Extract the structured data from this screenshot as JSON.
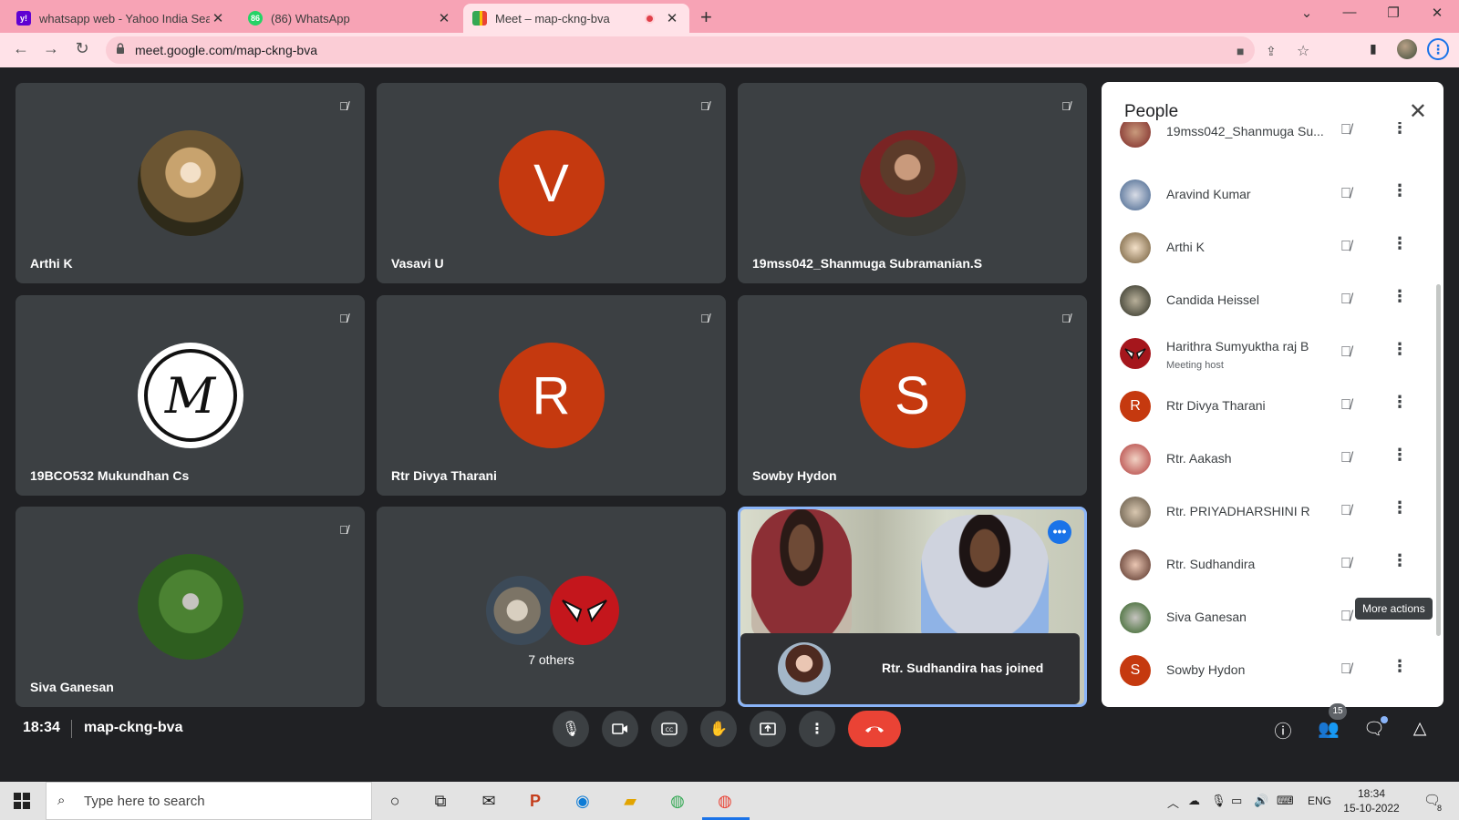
{
  "browser": {
    "tabs": [
      {
        "title": "whatsapp web - Yahoo India Sea",
        "favicon": "yahoo-icon",
        "color": "#6001d2"
      },
      {
        "title": "(86) WhatsApp",
        "favicon": "whatsapp-icon",
        "badge": "86",
        "color": "#25d366"
      },
      {
        "title": "Meet – map-ckng-bva",
        "favicon": "meet-icon",
        "recording": true
      }
    ],
    "url": "meet.google.com/map-ckng-bva"
  },
  "tiles": [
    {
      "name": "Arthi K",
      "avatar": "photo",
      "muted": true
    },
    {
      "name": "Vasavi U",
      "avatar": "letter",
      "letter": "V",
      "muted": true
    },
    {
      "name": "19mss042_Shanmuga Subramanian.S",
      "avatar": "photo",
      "muted": true
    },
    {
      "name": "19BCO532 Mukundhan Cs",
      "avatar": "logo",
      "letter": "M",
      "muted": true
    },
    {
      "name": "Rtr Divya Tharani",
      "avatar": "letter",
      "letter": "R",
      "muted": true
    },
    {
      "name": "Sowby Hydon",
      "avatar": "letter",
      "letter": "S",
      "muted": true
    },
    {
      "name": "Siva Ganesan",
      "avatar": "photo",
      "muted": true
    },
    {
      "name": "7 others",
      "avatar": "group"
    }
  ],
  "toast": {
    "message": "Rtr. Sudhandira has joined"
  },
  "people_panel": {
    "title": "People",
    "participants": [
      {
        "name": "19mss042_Shanmuga Su...",
        "avatar": "photo"
      },
      {
        "name": "Aravind Kumar",
        "avatar": "photo"
      },
      {
        "name": "Arthi K",
        "avatar": "photo"
      },
      {
        "name": "Candida Heissel",
        "avatar": "photo"
      },
      {
        "name": "Harithra Sumyuktha raj B",
        "subtitle": "Meeting host",
        "avatar": "photo"
      },
      {
        "name": "Rtr Divya Tharani",
        "avatar": "letter",
        "letter": "R"
      },
      {
        "name": "Rtr. Aakash",
        "avatar": "photo"
      },
      {
        "name": "Rtr. PRIYADHARSHINI R",
        "avatar": "photo"
      },
      {
        "name": "Rtr. Sudhandira",
        "avatar": "photo"
      },
      {
        "name": "Siva Ganesan",
        "avatar": "photo"
      },
      {
        "name": "Sowby Hydon",
        "avatar": "letter",
        "letter": "S"
      }
    ],
    "tooltip": "More actions"
  },
  "meeting": {
    "time": "18:34",
    "code": "map-ckng-bva",
    "people_count": "15"
  },
  "taskbar": {
    "search_placeholder": "Type here to search",
    "language": "ENG",
    "time": "18:34",
    "date": "15-10-2022",
    "notifications": "8"
  },
  "colors": {
    "accent": "#1a73e8",
    "end_call": "#ea4335",
    "letter_avatar": "#c5390f",
    "tab_strip": "#f7a3b5"
  }
}
